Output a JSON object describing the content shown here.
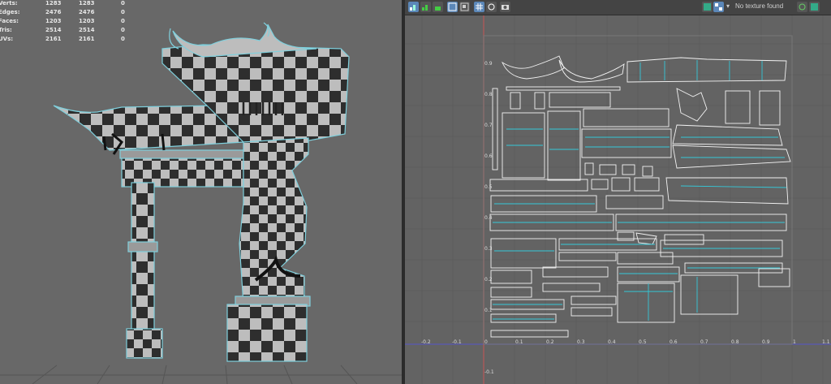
{
  "stats": {
    "rows": [
      {
        "label": "Verts:",
        "a": "1283",
        "b": "1283",
        "c": "0"
      },
      {
        "label": "Edges:",
        "a": "2476",
        "b": "2476",
        "c": "0"
      },
      {
        "label": "Faces:",
        "a": "1203",
        "b": "1203",
        "c": "0"
      },
      {
        "label": "Tris:",
        "a": "2514",
        "b": "2514",
        "c": "0"
      },
      {
        "label": "UVs:",
        "a": "2161",
        "b": "2161",
        "c": "0"
      }
    ]
  },
  "uv_editor": {
    "toolbar": {
      "icons": [
        "uv-shell-icon",
        "uv-distort-icon",
        "uv-stack-icon",
        "uv-flip-icon",
        "uv-select-icon",
        "uv-grid-icon",
        "uv-pivot-icon",
        "uv-snapshot-icon"
      ],
      "texture_status": "No texture found"
    },
    "axis": {
      "x_ticks": [
        "-0.2",
        "-0.1",
        "0",
        "0.1",
        "0.2",
        "0.3",
        "0.4",
        "0.5",
        "0.6",
        "0.7",
        "0.8",
        "0.9",
        "1",
        "1.1"
      ],
      "y_ticks": [
        "0.9",
        "0.8",
        "0.7",
        "0.6",
        "0.5",
        "0.4",
        "0.3",
        "0.2",
        "0.1",
        "-0.1"
      ]
    }
  },
  "colors": {
    "uv_edge": "#f2f2f2",
    "seam": "#35c8d8",
    "grid": "#5c5c5c",
    "axis_x": "#5a5aa8",
    "axis_y": "#a85a5a",
    "selected_icon": "#5b87b8"
  }
}
